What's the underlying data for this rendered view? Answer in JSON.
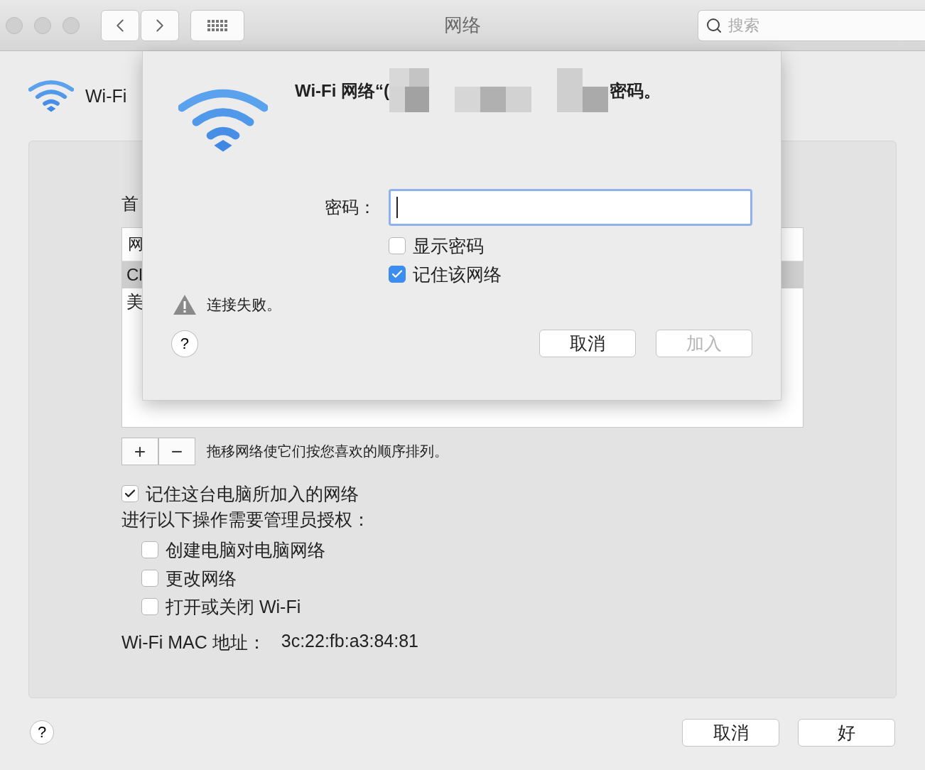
{
  "window": {
    "title": "网络",
    "search": {
      "placeholder": "搜索"
    }
  },
  "pane": {
    "icon_label": "Wi-Fi",
    "list_heading": "首",
    "table": {
      "column_1": "网",
      "rows": [
        {
          "cell": "Cl",
          "selected": true
        },
        {
          "cell": "美",
          "selected": false
        }
      ]
    },
    "list_buttons": [
      "+",
      "−"
    ],
    "list_hint": "拖移网络使它们按您喜欢的顺序排列。",
    "remember": {
      "label": "记住这台电脑所加入的网络",
      "checked": true
    },
    "admin_heading": "进行以下操作需要管理员授权：",
    "admin_options": [
      {
        "label": "创建电脑对电脑网络",
        "checked": false
      },
      {
        "label": "更改网络",
        "checked": false
      },
      {
        "label": "打开或关闭 Wi-Fi",
        "checked": false
      }
    ],
    "mac_label": "Wi-Fi MAC 地址：",
    "mac_value": "3c:22:fb:a3:84:81"
  },
  "footer": {
    "help": "?",
    "buttons": [
      {
        "label": "取消"
      },
      {
        "label": "好"
      }
    ]
  },
  "dialog": {
    "title_start": "Wi-Fi 网络“(",
    "title_end": "密码。",
    "password_label": "密码：",
    "options": [
      {
        "label": "显示密码",
        "checked": false
      },
      {
        "label": "记住该网络",
        "checked": true
      }
    ],
    "error": "连接失败。",
    "help": "?",
    "buttons": [
      {
        "label": "取消",
        "disabled": false
      },
      {
        "label": "加入",
        "disabled": true
      }
    ]
  }
}
